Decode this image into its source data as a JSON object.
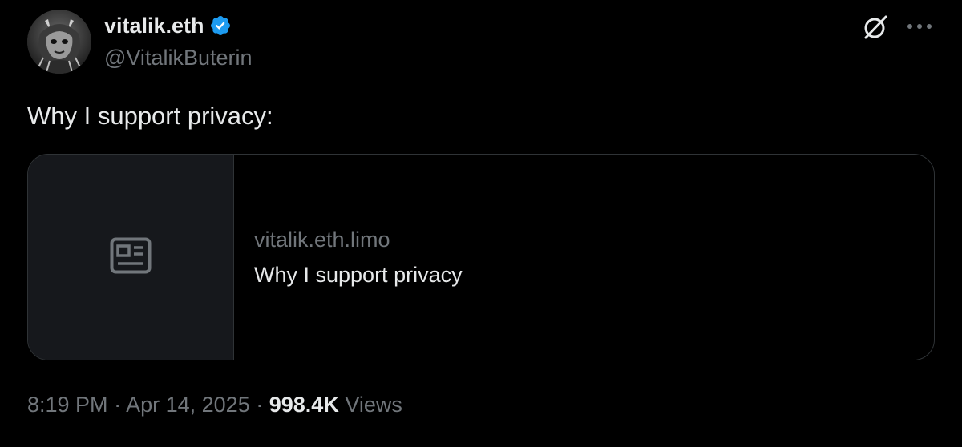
{
  "author": {
    "display_name": "vitalik.eth",
    "handle": "@VitalikButerin",
    "verified_icon": "verified-badge-icon",
    "verified_color": "#1d9bf0"
  },
  "header_actions": {
    "grok_icon": "grok-icon",
    "more_icon": "more-icon"
  },
  "tweet": {
    "text": "Why I support privacy:"
  },
  "link_card": {
    "thumbnail_icon": "article-icon",
    "domain": "vitalik.eth.limo",
    "title": "Why I support privacy"
  },
  "meta": {
    "time": "8:19 PM",
    "separator": "·",
    "date": "Apr 14, 2025",
    "views_count": "998.4K",
    "views_label": "Views"
  },
  "colors": {
    "background": "#000000",
    "primary_text": "#e7e9ea",
    "secondary_text": "#71767b",
    "border": "#2f3336",
    "card_thumb_bg": "#16181c"
  }
}
